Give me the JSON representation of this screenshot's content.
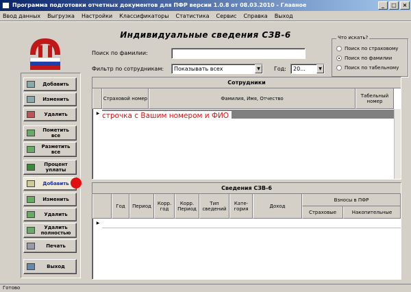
{
  "window": {
    "title": "Программа подготовки отчетных документов для ПФР версии 1.0.8 от 08.03.2010 - Главное",
    "buttons": [
      "_",
      "□",
      "×"
    ]
  },
  "menu": [
    "Ввод данных",
    "Выгрузка",
    "Настройки",
    "Классификаторы",
    "Статистика",
    "Сервис",
    "Справка",
    "Выход"
  ],
  "page_title": "Индивидуальные сведения СЗВ-6",
  "search": {
    "label": "Поиск по фамилии:",
    "value": ""
  },
  "filter": {
    "label": "Фильтр по сотрудникам:",
    "value": "Показывать всех"
  },
  "year": {
    "label": "Год:",
    "value": "20..."
  },
  "radio_group": {
    "legend": "Что искать?",
    "options": [
      {
        "label": "Поиск по страховому",
        "checked": false
      },
      {
        "label": "Поиск по фамилии",
        "checked": true
      },
      {
        "label": "Поиск по табельному",
        "checked": false
      }
    ]
  },
  "left_buttons": [
    {
      "label": "Добавить",
      "icon": "add-icon"
    },
    {
      "label": "Изменить",
      "icon": "edit-icon"
    },
    {
      "label": "Удалить",
      "icon": "delete-icon"
    },
    {
      "label": "Пометить все",
      "icon": "check-icon"
    },
    {
      "label": "Разметить все",
      "icon": "uncheck-icon"
    },
    {
      "label": "Процент уплаты",
      "icon": "money-icon"
    },
    {
      "label": "Добавить",
      "icon": "add-icon",
      "active": true
    },
    {
      "label": "Изменить",
      "icon": "edit-icon"
    },
    {
      "label": "Удалить",
      "icon": "delete-icon"
    },
    {
      "label": "Удалить полностью",
      "icon": "delete-all-icon"
    },
    {
      "label": "Печать",
      "icon": "print-icon"
    },
    {
      "label": "Выход",
      "icon": "exit-icon"
    }
  ],
  "employees_grid": {
    "caption": "Сотрудники",
    "headers": [
      "Страховой номер",
      "Фамилия, Имя, Отчество",
      "Табельный номер"
    ],
    "annotation": "строчка с Вашим номером и ФИО"
  },
  "svedenia_grid": {
    "caption": "Сведения СЗВ-6",
    "headers": [
      "Год",
      "Период",
      "Корр. год",
      "Корр. Период",
      "Тип сведений",
      "Кате-гория",
      "Доход"
    ],
    "group_header": "Взносы в ПФР",
    "sub_headers": [
      "Страховые",
      "Накопительные"
    ]
  },
  "status": "Готово",
  "colors": {
    "title_start": "#0a246a",
    "title_end": "#a6caf0",
    "selection": "#808080",
    "annotation": "#d01818",
    "marker": "#e01010"
  }
}
